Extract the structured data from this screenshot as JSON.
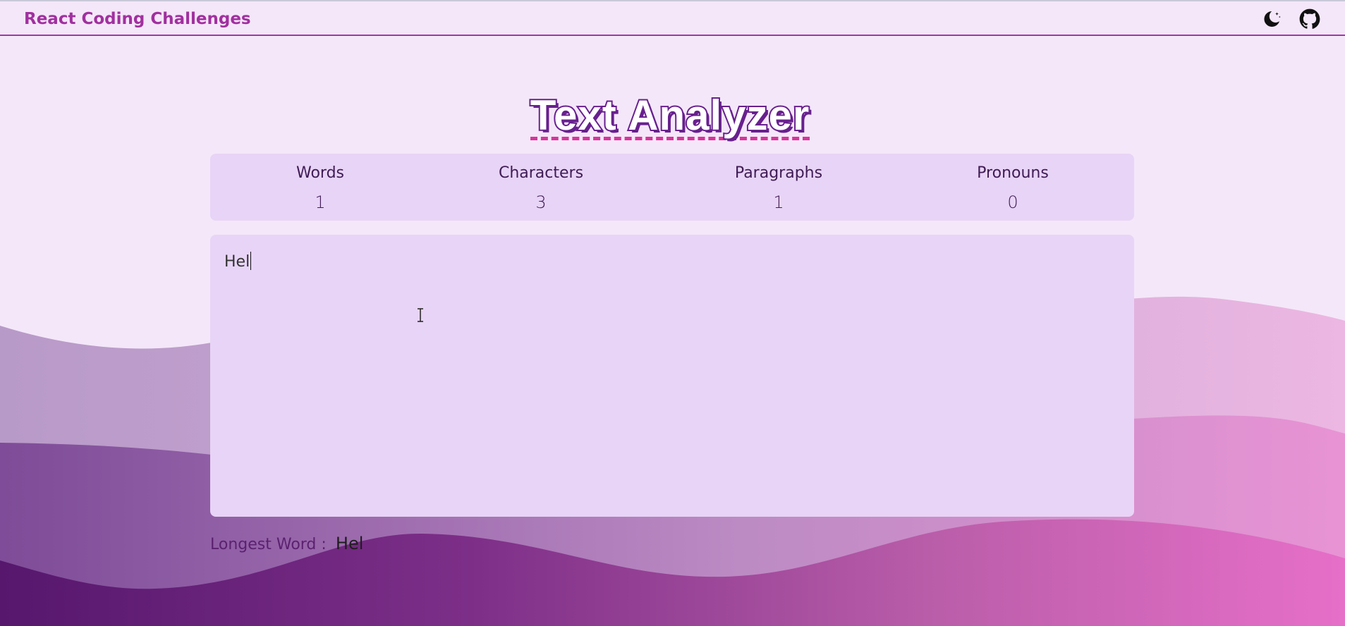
{
  "navbar": {
    "brand": "React Coding Challenges",
    "theme_toggle_icon": "moon-stars-icon",
    "github_icon": "github-icon"
  },
  "main": {
    "title": "Text Analyzer",
    "stats": [
      {
        "label": "Words",
        "value": "1"
      },
      {
        "label": "Characters",
        "value": "3"
      },
      {
        "label": "Paragraphs",
        "value": "1"
      },
      {
        "label": "Pronouns",
        "value": "0"
      }
    ],
    "editor": {
      "value": "Hel"
    },
    "longest_word": {
      "label": "Longest Word :",
      "value": "Hel"
    }
  },
  "colors": {
    "background": "#f4e7f9",
    "brand": "#a1309f",
    "card": "#e8d4f6",
    "title_outline": "#68208e",
    "title_underline": "#d6359a",
    "wave_dark": "#58156f",
    "wave_pink": "#e67bc9"
  }
}
